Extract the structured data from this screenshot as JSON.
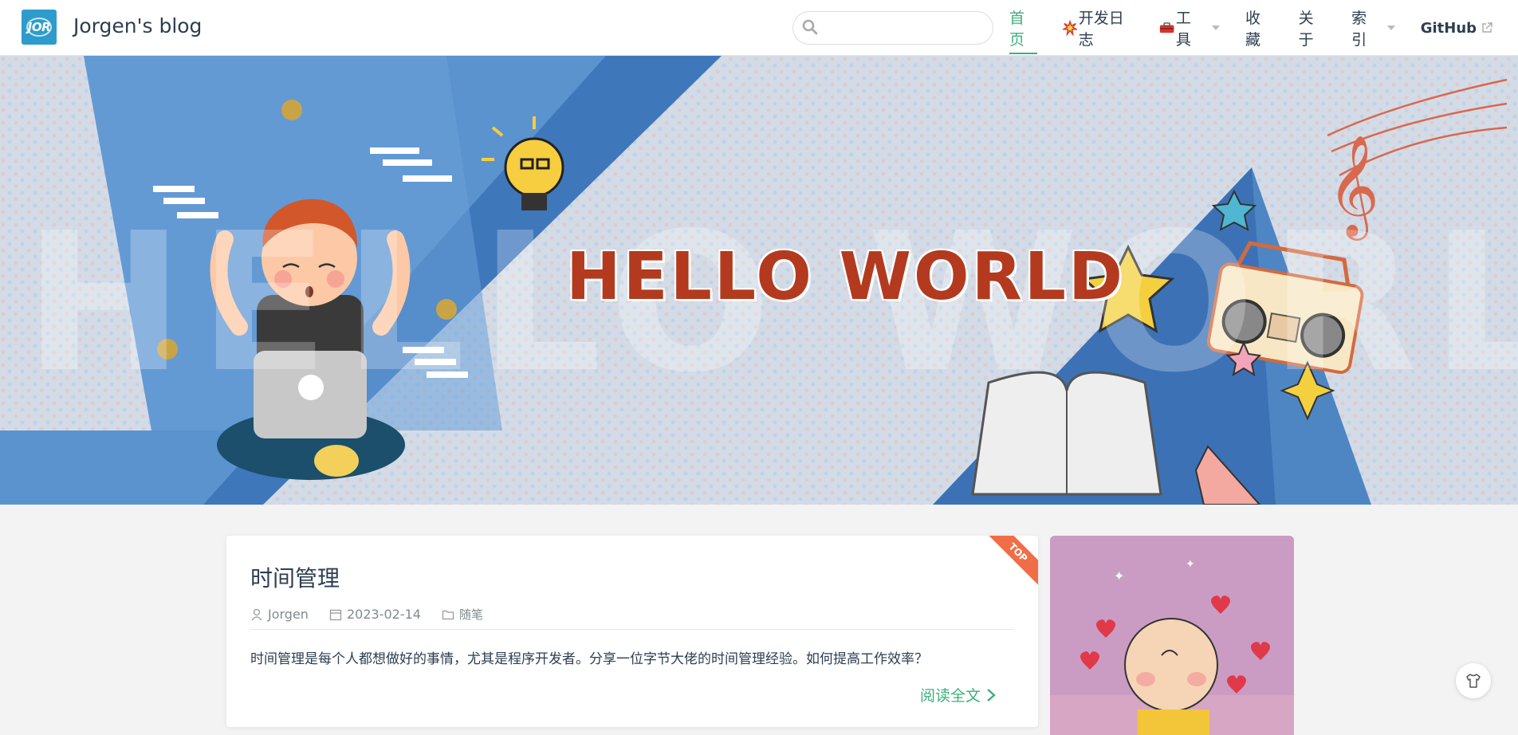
{
  "site": {
    "logo_text": "JOR",
    "name": "Jorgen's blog"
  },
  "search": {
    "placeholder": "",
    "value": ""
  },
  "nav": {
    "items": [
      {
        "label": "首页",
        "active": true
      },
      {
        "label": "开发日志"
      },
      {
        "label": "工具",
        "dropdown": true
      },
      {
        "label": "收藏"
      },
      {
        "label": "关于"
      },
      {
        "label": "索引",
        "dropdown": true
      },
      {
        "label": "GitHub",
        "external": true
      }
    ]
  },
  "banner": {
    "title": "HELLO WORLD",
    "watermark": "HELLO WORLD"
  },
  "post": {
    "title": "时间管理",
    "badge": "TOP",
    "author": "Jorgen",
    "date": "2023-02-14",
    "category": "随笔",
    "excerpt": "时间管理是每个人都想做好的事情，尤其是程序开发者。分享一位字节大佬的时间管理经验。如何提高工作效率？",
    "read_more": "阅读全文"
  },
  "colors": {
    "accent": "#3eaf7c",
    "ribbon": "#f06d48",
    "title_red": "#b33a1e",
    "logo": "#2d9ccc"
  }
}
